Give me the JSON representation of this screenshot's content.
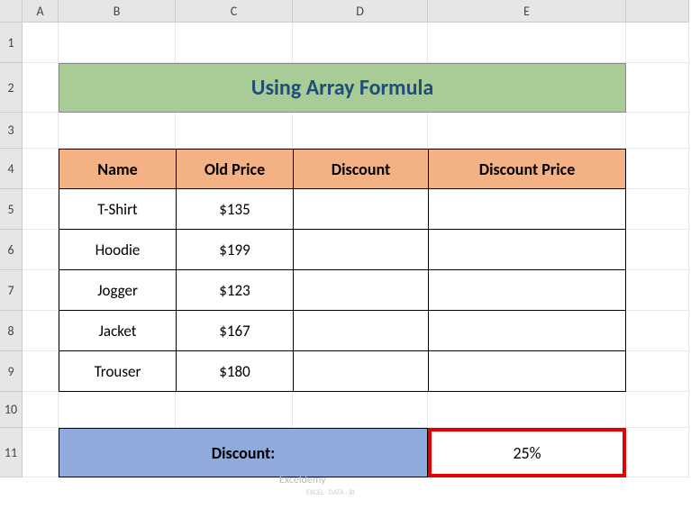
{
  "columns": [
    "A",
    "B",
    "C",
    "D",
    "E"
  ],
  "rows": [
    "1",
    "2",
    "3",
    "4",
    "5",
    "6",
    "7",
    "8",
    "9",
    "10",
    "11"
  ],
  "title": "Using Array Formula",
  "table": {
    "headers": [
      "Name",
      "Old Price",
      "Discount",
      "Discount Price"
    ],
    "rows": [
      {
        "name": "T-Shirt",
        "old_price": "$135",
        "discount": "",
        "discount_price": ""
      },
      {
        "name": "Hoodie",
        "old_price": "$199",
        "discount": "",
        "discount_price": ""
      },
      {
        "name": "Jogger",
        "old_price": "$123",
        "discount": "",
        "discount_price": ""
      },
      {
        "name": "Jacket",
        "old_price": "$167",
        "discount": "",
        "discount_price": ""
      },
      {
        "name": "Trouser",
        "old_price": "$180",
        "discount": "",
        "discount_price": ""
      }
    ]
  },
  "discount": {
    "label": "Discount:",
    "value": "25%"
  },
  "watermark": "Exceldemy",
  "watermark_sub": "EXCEL · DATA · BI",
  "chart_data": {
    "type": "table",
    "title": "Using Array Formula",
    "headers": [
      "Name",
      "Old Price",
      "Discount",
      "Discount Price"
    ],
    "data": [
      [
        "T-Shirt",
        135,
        null,
        null
      ],
      [
        "Hoodie",
        199,
        null,
        null
      ],
      [
        "Jogger",
        123,
        null,
        null
      ],
      [
        "Jacket",
        167,
        null,
        null
      ],
      [
        "Trouser",
        180,
        null,
        null
      ]
    ],
    "discount_rate": 0.25
  }
}
